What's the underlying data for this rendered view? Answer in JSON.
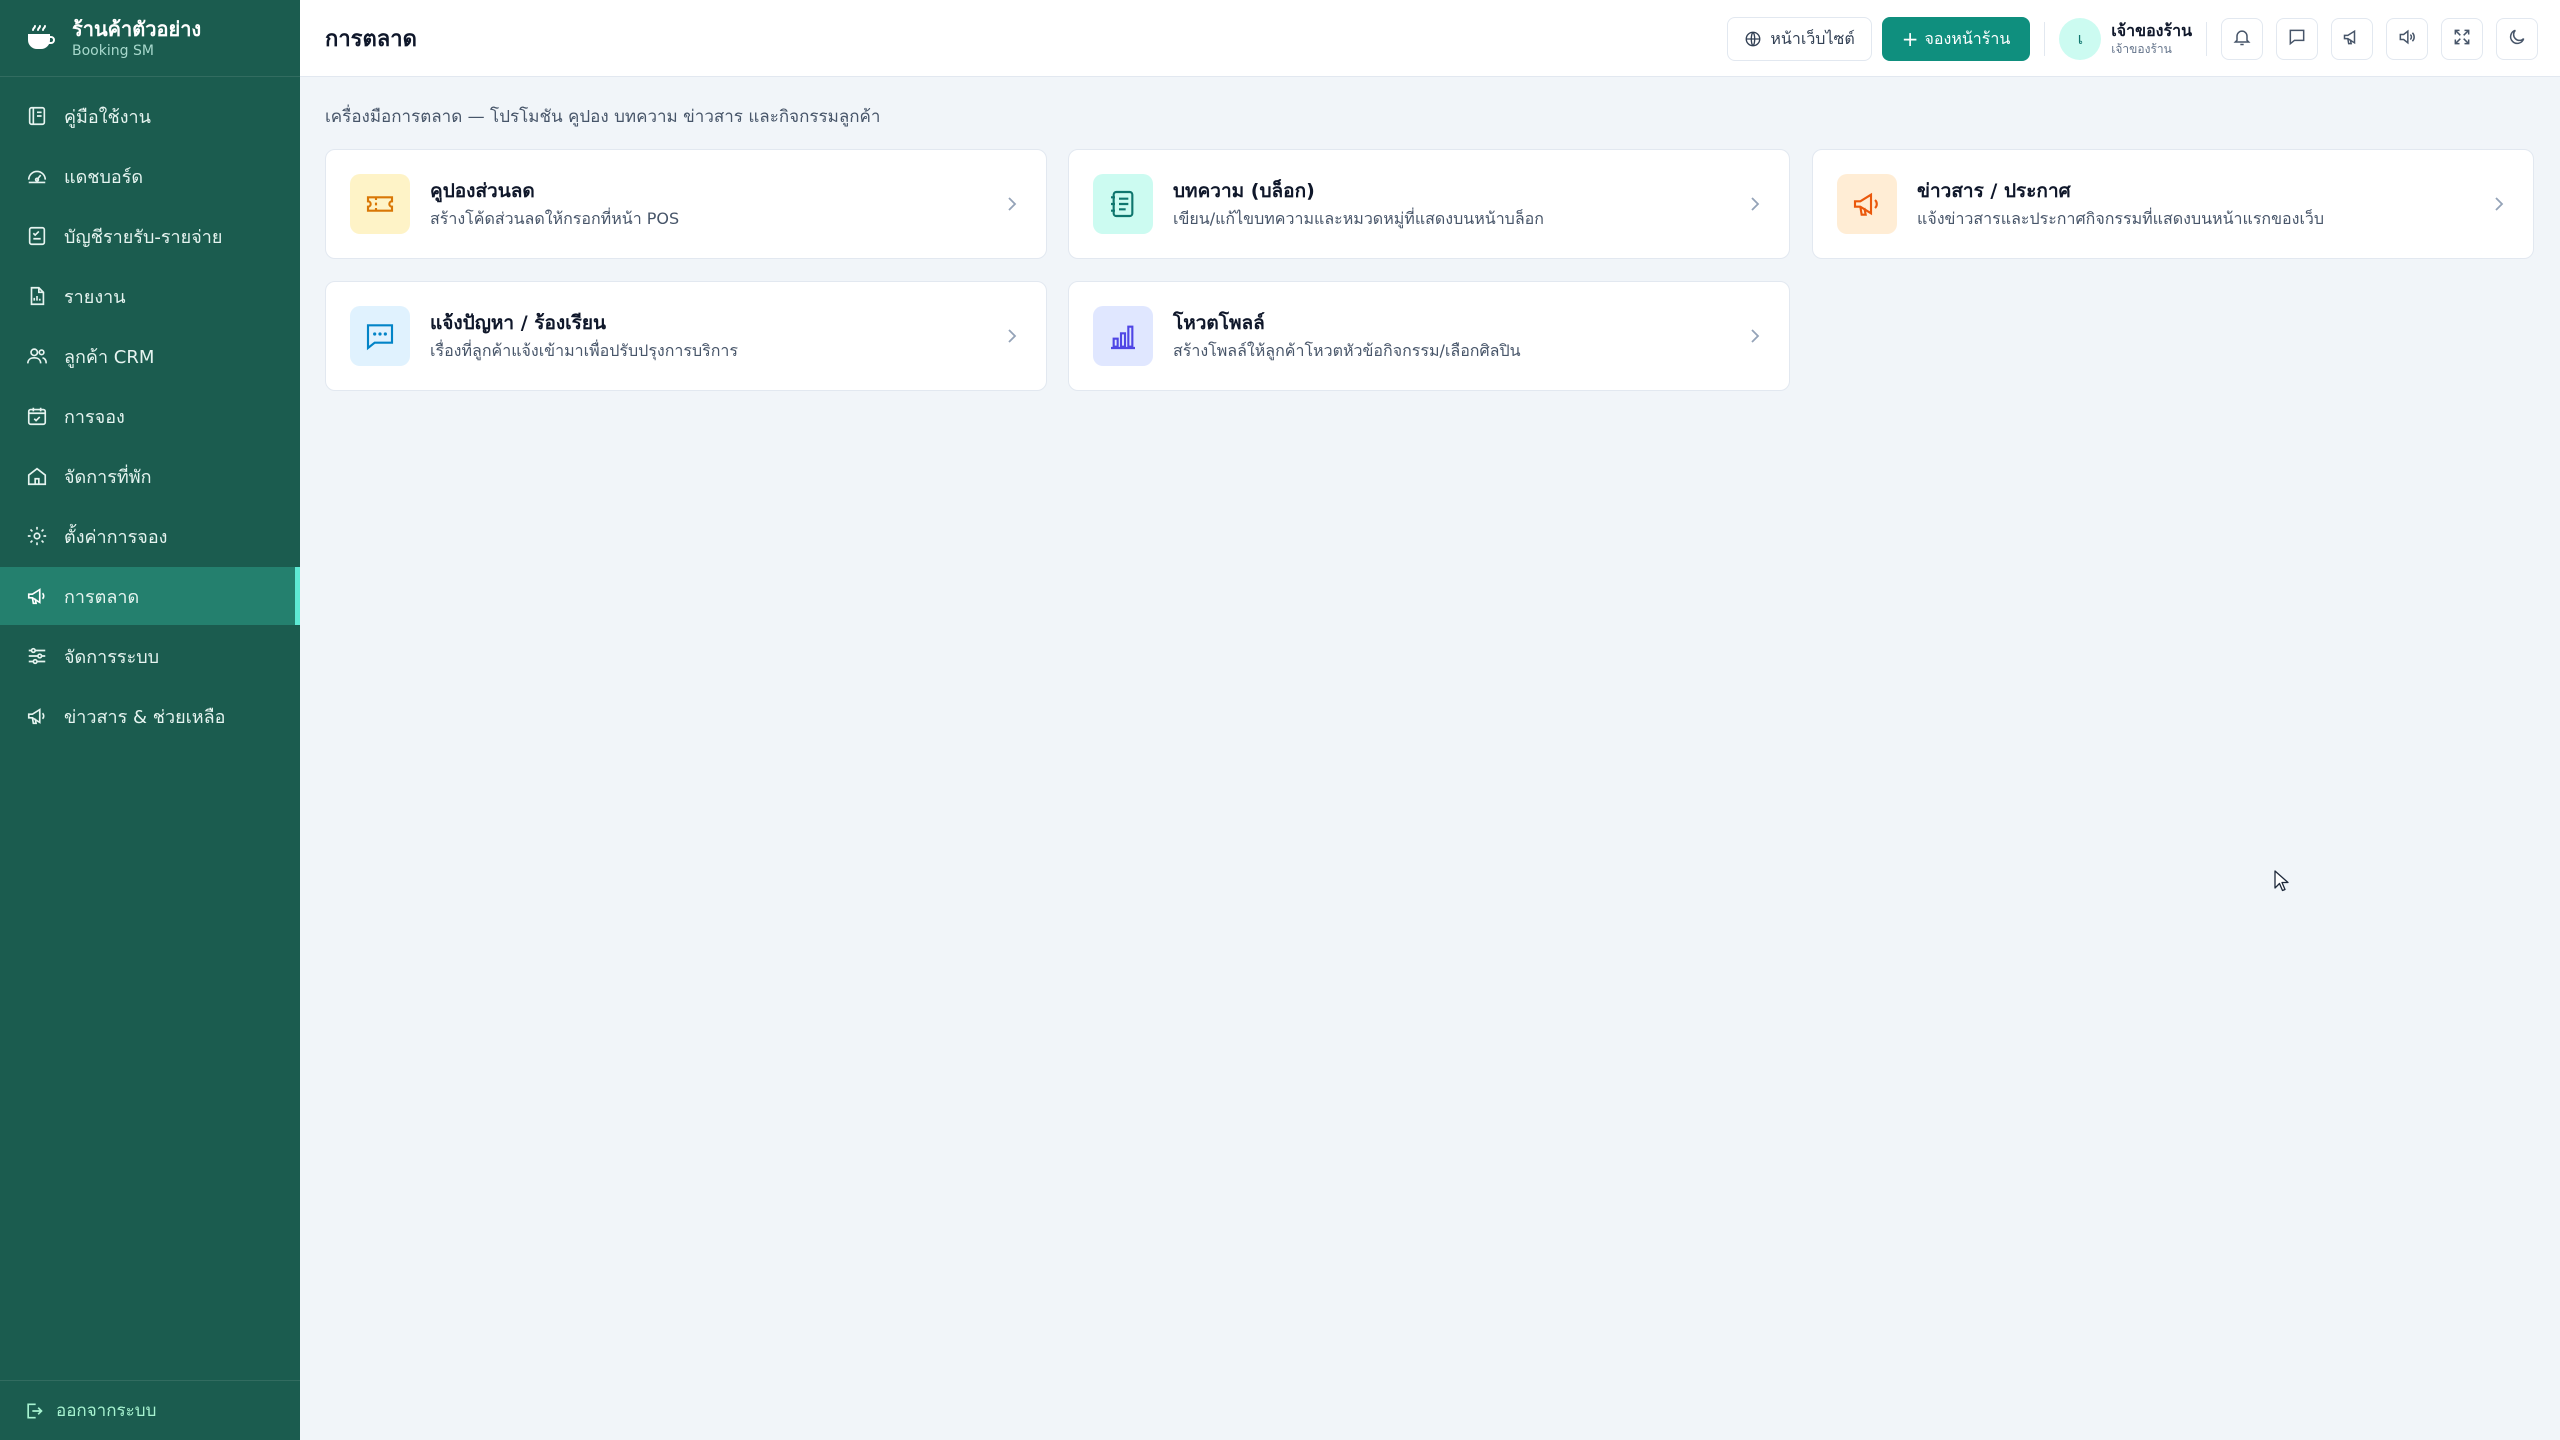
{
  "brand": {
    "name": "ร้านค้าตัวอย่าง",
    "sub": "Booking SM",
    "icon": "coffee-cup-icon"
  },
  "sidebar": {
    "items": [
      {
        "label": "คู่มือใช้งาน",
        "icon": "book-icon"
      },
      {
        "label": "แดชบอร์ด",
        "icon": "gauge-icon"
      },
      {
        "label": "บัญชีรายรับ-รายจ่าย",
        "icon": "ledger-icon"
      },
      {
        "label": "รายงาน",
        "icon": "report-icon"
      },
      {
        "label": "ลูกค้า CRM",
        "icon": "users-icon"
      },
      {
        "label": "การจอง",
        "icon": "calendar-check-icon"
      },
      {
        "label": "จัดการที่พัก",
        "icon": "house-icon"
      },
      {
        "label": "ตั้งค่าการจอง",
        "icon": "gear-icon"
      },
      {
        "label": "การตลาด",
        "icon": "megaphone-icon",
        "active": true
      },
      {
        "label": "จัดการระบบ",
        "icon": "sliders-icon"
      },
      {
        "label": "ข่าวสาร & ช่วยเหลือ",
        "icon": "megaphone-icon"
      }
    ],
    "logout": "ออกจากระบบ"
  },
  "header": {
    "title": "การตลาด",
    "website_label": "หน้าเว็บไซต์",
    "book_label": "จองหน้าร้าน",
    "user": {
      "initial": "เ",
      "name": "เจ้าของร้าน",
      "role": "เจ้าของร้าน"
    },
    "icons": [
      "bell-icon",
      "chat-icon",
      "megaphone-icon",
      "speaker-icon",
      "fullscreen-icon",
      "moon-icon"
    ]
  },
  "main": {
    "subtitle": "เครื่องมือการตลาด — โปรโมชัน คูปอง บทความ ข่าวสาร และกิจกรรมลูกค้า",
    "cards": [
      {
        "title": "คูปองส่วนลด",
        "desc": "สร้างโค้ดส่วนลดให้กรอกที่หน้า POS",
        "icon": "ticket-icon",
        "bg": "#fef3c7",
        "color": "#d97706"
      },
      {
        "title": "บทความ (บล็อก)",
        "desc": "เขียน/แก้ไขบทความและหมวดหมู่ที่แสดงบนหน้าบล็อก",
        "icon": "notebook-icon",
        "bg": "#ccfbf1",
        "color": "#0f766e"
      },
      {
        "title": "ข่าวสาร / ประกาศ",
        "desc": "แจ้งข่าวสารและประกาศกิจกรรมที่แสดงบนหน้าแรกของเว็บ",
        "icon": "megaphone-icon",
        "bg": "#ffedd5",
        "color": "#ea580c"
      },
      {
        "title": "แจ้งปัญหา / ร้องเรียน",
        "desc": "เรื่องที่ลูกค้าแจ้งเข้ามาเพื่อปรับปรุงการบริการ",
        "icon": "message-icon",
        "bg": "#e0f2fe",
        "color": "#0284c7"
      },
      {
        "title": "โหวตโพลล์",
        "desc": "สร้างโพลล์ให้ลูกค้าโหวตหัวข้อกิจกรรม/เลือกศิลปิน",
        "icon": "bar-chart-icon",
        "bg": "#e0e7ff",
        "color": "#4f46e5"
      }
    ]
  }
}
